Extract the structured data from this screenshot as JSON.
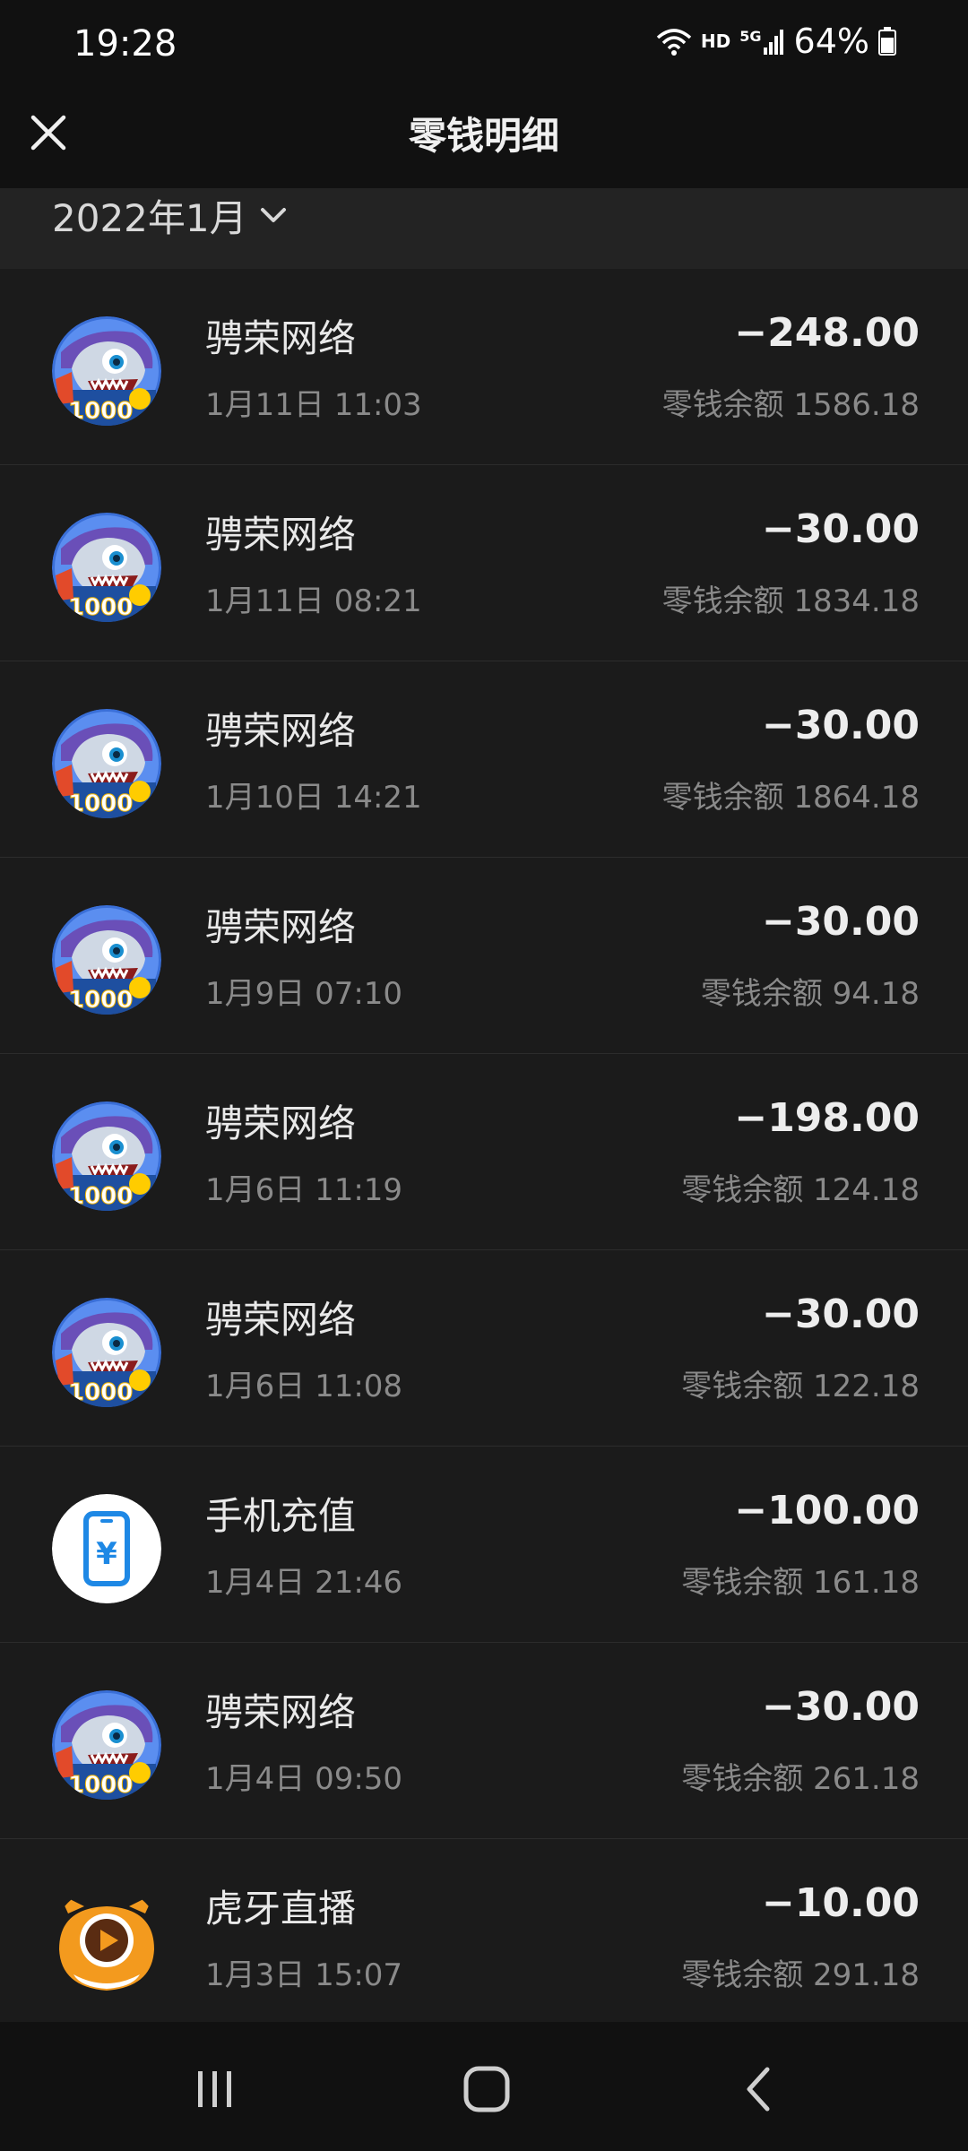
{
  "status_bar": {
    "time": "19:28",
    "network_label": "HD",
    "signal_label": "5G",
    "battery": "64%"
  },
  "header": {
    "title": "零钱明细",
    "close_icon": "close-icon"
  },
  "filter": {
    "month": "2022年1月",
    "dropdown_icon": "chevron-down-icon"
  },
  "transactions": [
    {
      "name": "骋荣网络",
      "time": "1月11日 11:03",
      "amount": "−248.00",
      "balance": "零钱余额 1586.18",
      "icon": "shark-game-icon"
    },
    {
      "name": "骋荣网络",
      "time": "1月11日 08:21",
      "amount": "−30.00",
      "balance": "零钱余额 1834.18",
      "icon": "shark-game-icon"
    },
    {
      "name": "骋荣网络",
      "time": "1月10日 14:21",
      "amount": "−30.00",
      "balance": "零钱余额 1864.18",
      "icon": "shark-game-icon"
    },
    {
      "name": "骋荣网络",
      "time": "1月9日 07:10",
      "amount": "−30.00",
      "balance": "零钱余额 94.18",
      "icon": "shark-game-icon"
    },
    {
      "name": "骋荣网络",
      "time": "1月6日 11:19",
      "amount": "−198.00",
      "balance": "零钱余额 124.18",
      "icon": "shark-game-icon"
    },
    {
      "name": "骋荣网络",
      "time": "1月6日 11:08",
      "amount": "−30.00",
      "balance": "零钱余额 122.18",
      "icon": "shark-game-icon"
    },
    {
      "name": "手机充值",
      "time": "1月4日 21:46",
      "amount": "−100.00",
      "balance": "零钱余额 161.18",
      "icon": "phone-recharge-icon"
    },
    {
      "name": "骋荣网络",
      "time": "1月4日 09:50",
      "amount": "−30.00",
      "balance": "零钱余额 261.18",
      "icon": "shark-game-icon"
    },
    {
      "name": "虎牙直播",
      "time": "1月3日 15:07",
      "amount": "−10.00",
      "balance": "零钱余额 291.18",
      "icon": "huya-live-icon"
    }
  ],
  "nav": {
    "recents_icon": "recents-icon",
    "home_icon": "home-icon",
    "back_icon": "back-icon"
  },
  "colors": {
    "background": "#1b1b1b",
    "bar": "#111111",
    "month_bar": "#232323",
    "primary_text": "#e9e9e9",
    "secondary_text": "#8a8a8a",
    "recharge_blue": "#1e88e5",
    "huya_orange": "#f39a1e"
  }
}
